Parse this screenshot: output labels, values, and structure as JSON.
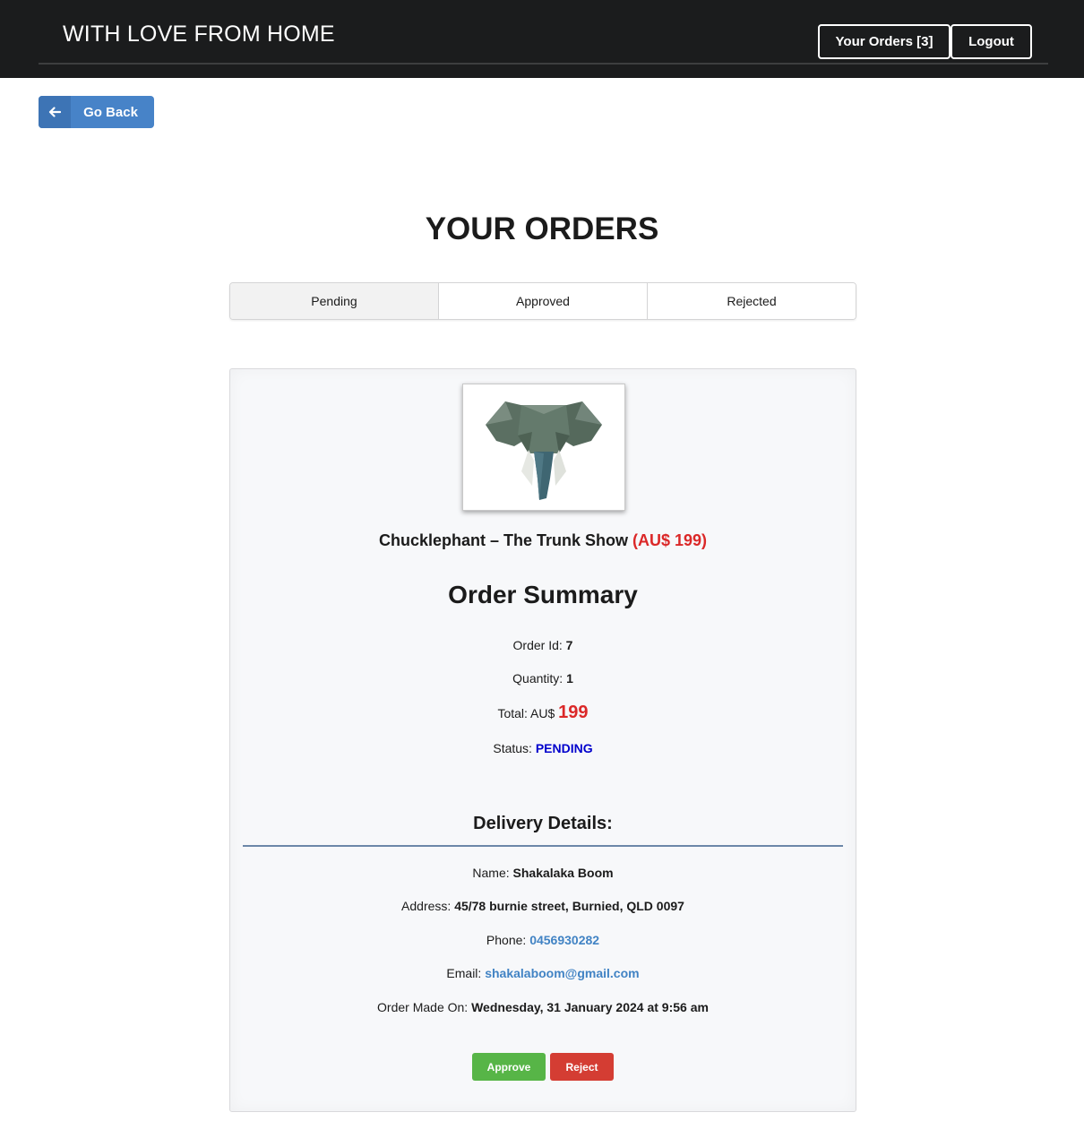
{
  "header": {
    "brand": "WITH LOVE FROM HOME",
    "orders_label": "Your Orders [3]",
    "logout_label": "Logout"
  },
  "back_button": {
    "label": "Go Back",
    "icon": "arrow-left-icon"
  },
  "page_title": "YOUR ORDERS",
  "tabs": [
    {
      "label": "Pending",
      "active": true
    },
    {
      "label": "Approved",
      "active": false
    },
    {
      "label": "Rejected",
      "active": false
    }
  ],
  "order": {
    "product_image": "elephant-head-sculpture",
    "product_name": "Chucklephant – The Trunk Show",
    "product_price": "(AU$ 199)",
    "summary_title": "Order Summary",
    "order_id_label": "Order Id:",
    "order_id": "7",
    "quantity_label": "Quantity:",
    "quantity": "1",
    "total_label": "Total: AU$",
    "total": "199",
    "status_label": "Status:",
    "status": "PENDING",
    "delivery_title": "Delivery Details:",
    "name_label": "Name:",
    "name": "Shakalaka Boom",
    "address_label": "Address:",
    "address": "45/78 burnie street, Burnied, QLD 0097",
    "phone_label": "Phone:",
    "phone": "0456930282",
    "email_label": "Email:",
    "email": "shakalaboom@gmail.com",
    "date_label": "Order Made On:",
    "date": "Wednesday, 31 January 2024 at 9:56 am",
    "approve_label": "Approve",
    "reject_label": "Reject"
  },
  "colors": {
    "header_bg": "#1b1c1d",
    "primary": "#4783c8",
    "price_red": "#db2828",
    "status_blue": "#0000cc",
    "link_blue": "#4183c4",
    "approve_green": "#57b547",
    "reject_red": "#d43d33"
  }
}
